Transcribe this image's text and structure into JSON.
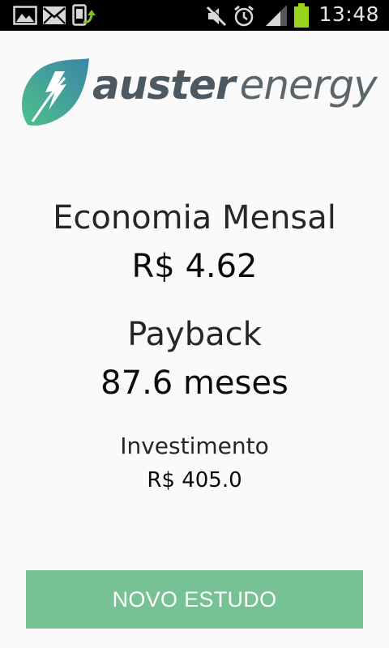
{
  "status_bar": {
    "time": "13:48",
    "icons": [
      "gallery-icon",
      "mail-icon",
      "sync-icon",
      "mute-icon",
      "alarm-icon",
      "signal-icon",
      "battery-icon"
    ]
  },
  "logo": {
    "word_bold": "auster",
    "word_light": "energy"
  },
  "results": {
    "monthly_savings_label": "Economia Mensal",
    "monthly_savings_value": "R$ 4.62",
    "payback_label": "Payback",
    "payback_value": "87.6 meses",
    "investment_label": "Investimento",
    "investment_value": "R$ 405.0"
  },
  "actions": {
    "new_study_label": "NOVO ESTUDO"
  },
  "colors": {
    "accent_button": "#77c295",
    "logo_green": "#4fbf8b",
    "logo_blue": "#3b8ea6",
    "battery": "#9ad31c"
  }
}
